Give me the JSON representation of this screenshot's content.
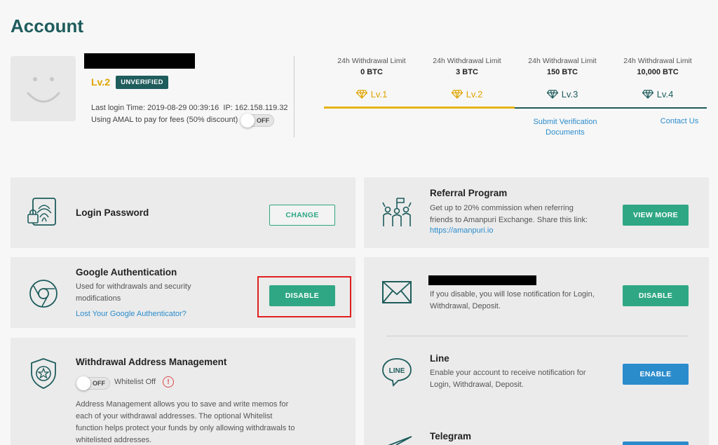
{
  "page": {
    "title": "Account"
  },
  "profile": {
    "level": "Lv.2",
    "status_badge": "UNVERIFIED",
    "last_login_label": "Last login Time:",
    "last_login_time": "2019-08-29 00:39:16",
    "ip_label": "IP:",
    "ip": "162.158.119.32",
    "amal_text": "Using AMAL to pay for fees (50% discount)",
    "amal_toggle": "OFF"
  },
  "levels": [
    {
      "limit_label": "24h Withdrawal Limit",
      "limit_value": "0 BTC",
      "level": "Lv.1",
      "color": "#e0a400"
    },
    {
      "limit_label": "24h Withdrawal Limit",
      "limit_value": "3 BTC",
      "level": "Lv.2",
      "color": "#e0a400"
    },
    {
      "limit_label": "24h Withdrawal Limit",
      "limit_value": "150 BTC",
      "level": "Lv.3",
      "color": "#1f5c5c"
    },
    {
      "limit_label": "24h Withdrawal Limit",
      "limit_value": "10,000 BTC",
      "level": "Lv.4",
      "color": "#1f5c5c"
    }
  ],
  "links": {
    "submit_verification": "Submit Verification Documents",
    "contact_us": "Contact Us"
  },
  "security": {
    "login_password": {
      "title": "Login Password",
      "button": "CHANGE"
    },
    "google_auth": {
      "title": "Google Authentication",
      "desc": "Used for withdrawals and security modifications",
      "link": "Lost Your Google Authenticator?",
      "button": "DISABLE"
    },
    "withdrawal_address": {
      "title": "Withdrawal Address Management",
      "toggle": "OFF",
      "whitelist_status": "Whitelist Off",
      "desc": "Address Management allows you to save and write memos for each of your withdrawal addresses. The optional Whitelist function helps protect your funds by only allowing withdrawals to whitelisted addresses."
    }
  },
  "referral": {
    "title": "Referral Program",
    "desc": "Get up to 20% commission when referring friends to Amanpuri Exchange. Share this link:",
    "link": "https://amanpuri.io",
    "button": "VIEW MORE"
  },
  "notifications": {
    "email": {
      "desc": "If you disable, you will lose notification for Login, Withdrawal, Deposit.",
      "button": "DISABLE"
    },
    "line": {
      "title": "Line",
      "icon_text": "LINE",
      "desc": "Enable your account to receive notification for Login, Withdrawal, Deposit.",
      "button": "ENABLE"
    },
    "telegram": {
      "title": "Telegram"
    }
  },
  "colors": {
    "brand": "#1f5c5c",
    "green": "#2fa784",
    "gold": "#e0a400",
    "blue": "#2b8ccc",
    "highlight": "#e02020"
  }
}
